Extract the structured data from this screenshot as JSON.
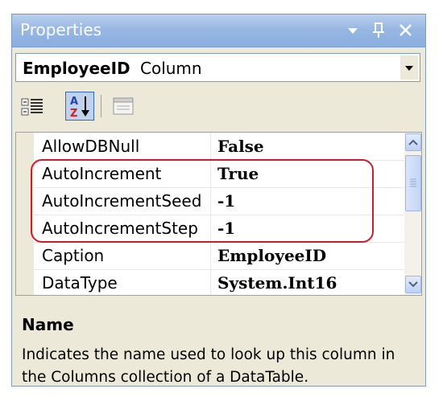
{
  "window": {
    "title": "Properties"
  },
  "titlebar_buttons": [
    {
      "icon": "dropdown-arrow-icon"
    },
    {
      "icon": "pin-icon"
    },
    {
      "icon": "close-icon"
    }
  ],
  "object_selector": {
    "name": "EmployeeID",
    "type": "Column"
  },
  "toolbar": {
    "tools": [
      {
        "icon": "categorized-icon",
        "active": false
      },
      {
        "icon": "alphabetical-icon",
        "active": true
      },
      {
        "icon": "property-pages-icon",
        "active": false
      }
    ]
  },
  "properties": [
    {
      "name": "AllowDBNull",
      "value": "False"
    },
    {
      "name": "AutoIncrement",
      "value": "True"
    },
    {
      "name": "AutoIncrementSeed",
      "value": "-1"
    },
    {
      "name": "AutoIncrementStep",
      "value": "-1"
    },
    {
      "name": "Caption",
      "value": "EmployeeID"
    },
    {
      "name": "DataType",
      "value": "System.Int16"
    }
  ],
  "description": {
    "title": "Name",
    "text": "Indicates the name used to look up this column in the Columns collection of a DataTable."
  },
  "colors": {
    "highlight": "#d11a2a",
    "titlebar": "#98b7e3",
    "panel": "#ece9d8"
  }
}
